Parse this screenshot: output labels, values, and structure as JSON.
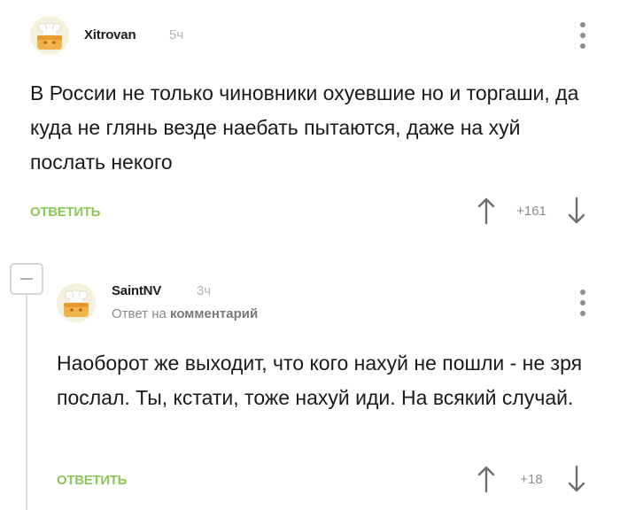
{
  "comments": [
    {
      "username": "Xitrovan",
      "time": "5ч",
      "text": "В России не только чиновники охуевшие но и торгаши, да куда не глянь везде наебать пытаются, даже на хуй послать некого",
      "reply_label": "ОТВЕТИТЬ",
      "rating": "+161"
    },
    {
      "username": "SaintNV",
      "time": "3ч",
      "reply_to_prefix": "Ответ на",
      "reply_to_link": "комментарий",
      "text": "Наоборот же выходит, что кого нахуй не пошли - не зря послал. Ты, кстати, тоже нахуй иди. На всякий случай.",
      "reply_label": "ОТВЕТИТЬ",
      "rating": "+18"
    }
  ],
  "icons": {
    "upvote": "arrow-up-icon",
    "downvote": "arrow-down-icon",
    "menu": "more-vertical-icon",
    "collapse": "minus-icon",
    "avatar": "chef-hat-avatar"
  },
  "colors": {
    "accent_green": "#8ac858",
    "meta_gray": "#b5b5b5",
    "icon_gray": "#8e8e8e"
  }
}
